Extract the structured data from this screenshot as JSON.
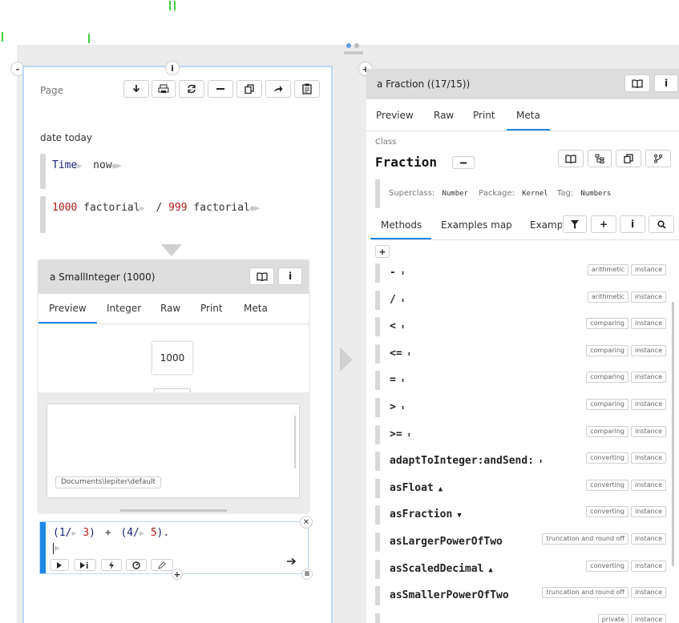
{
  "left_panel": {
    "title": "Page",
    "toolbar_icons": [
      "download-icon",
      "print-icon",
      "refresh-icon",
      "minus-icon",
      "copy-icon",
      "share-icon",
      "clipboard-icon"
    ],
    "heading": "date today",
    "snippet1": {
      "receiver": "Time",
      "message": "now"
    },
    "snippet2": {
      "n1": "1000",
      "m1": "factorial",
      "op": "/",
      "n2": "999",
      "m2": "factorial"
    },
    "inspector": {
      "title": "a SmallInteger (1000)",
      "tabs": [
        "Preview",
        "Integer",
        "Raw",
        "Print",
        "Meta"
      ],
      "active_tab": "Preview",
      "value": "1000",
      "path": "Documents\\lepiter\\default"
    },
    "editor": {
      "t1": "(1/",
      "t2": "3",
      "t3": ")",
      "t4": "+",
      "t5": "(4/",
      "t6": "5",
      "t7": ")",
      "t8": "."
    }
  },
  "right_panel": {
    "title": "a Fraction ((17/15))",
    "tabs": [
      "Preview",
      "Raw",
      "Print",
      "Meta"
    ],
    "active_tab": "Meta",
    "class_label": "Class",
    "class_name": "Fraction",
    "superclass_label": "Superclass:",
    "superclass": "Number",
    "package_label": "Package:",
    "package": "Kernel",
    "tag_label": "Tag:",
    "tag": "Numbers",
    "method_tabs": [
      "Methods",
      "Examples map",
      "Examp"
    ],
    "active_method_tab": "Methods",
    "methods": [
      {
        "name": "-",
        "caret": "⬍",
        "category": "arithmetic",
        "side": "instance"
      },
      {
        "name": "/",
        "caret": "⬍",
        "category": "arithmetic",
        "side": "instance"
      },
      {
        "name": "<",
        "caret": "⬍",
        "category": "comparing",
        "side": "instance"
      },
      {
        "name": "<=",
        "caret": "⬍",
        "category": "comparing",
        "side": "instance"
      },
      {
        "name": "=",
        "caret": "⬍",
        "category": "comparing",
        "side": "instance"
      },
      {
        "name": ">",
        "caret": "⬍",
        "category": "comparing",
        "side": "instance"
      },
      {
        "name": ">=",
        "caret": "⬍",
        "category": "comparing",
        "side": "instance"
      },
      {
        "name": "adaptToInteger:andSend:",
        "caret": "⬍",
        "category": "converting",
        "side": "instance"
      },
      {
        "name": "asFloat",
        "caret": "▲",
        "category": "converting",
        "side": "instance"
      },
      {
        "name": "asFraction",
        "caret": "▼",
        "category": "converting",
        "side": "instance"
      },
      {
        "name": "asLargerPowerOfTwo",
        "caret": "",
        "category": "truncation and round off",
        "side": "instance"
      },
      {
        "name": "asScaledDecimal",
        "caret": "▲",
        "category": "converting",
        "side": "instance"
      },
      {
        "name": "asSmallerPowerOfTwo",
        "caret": "",
        "category": "truncation and round off",
        "side": "instance"
      },
      {
        "name": "",
        "caret": "",
        "category": "private",
        "side": "instance"
      }
    ]
  },
  "colors": {
    "accent": "#1e88e5",
    "keyword": "#1a237e",
    "number": "#b71c1c",
    "header_bg": "#dddddd"
  }
}
